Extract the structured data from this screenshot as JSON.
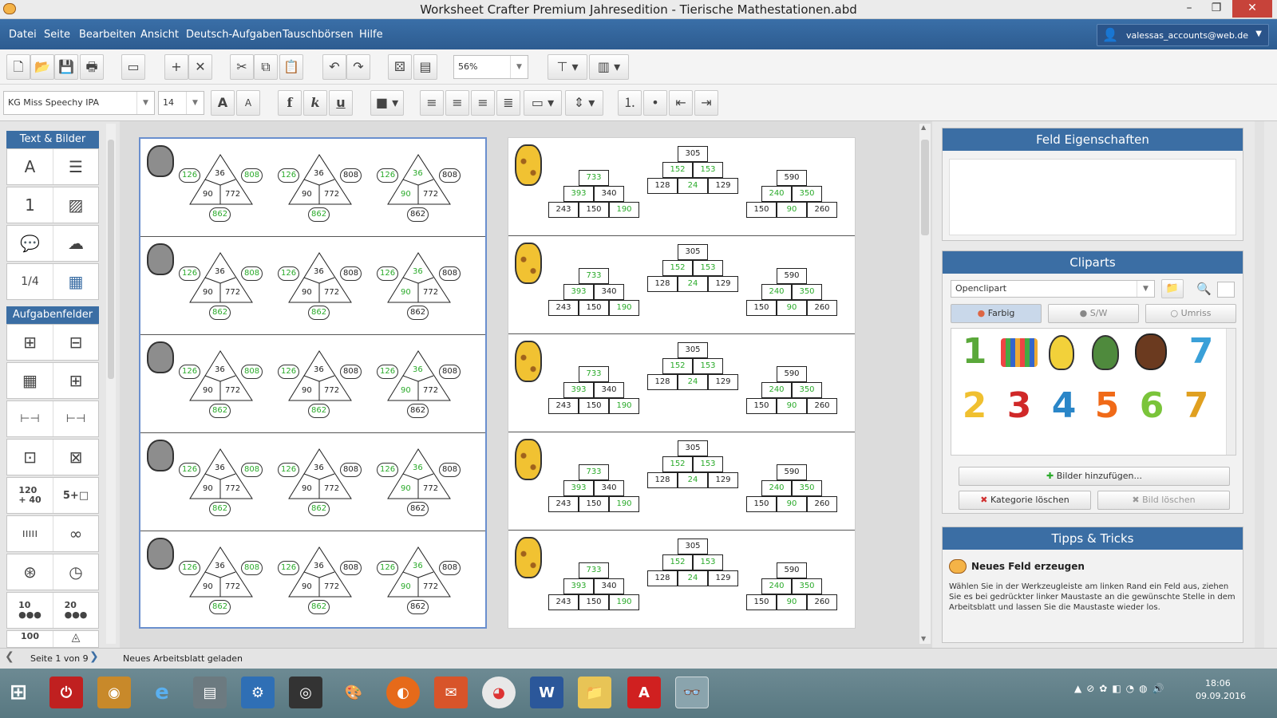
{
  "window": {
    "title": "Worksheet Crafter Premium Jahresedition - Tierische Mathestationen.abd",
    "minimize": "–",
    "maximize": "❐",
    "close": "✕"
  },
  "menu": [
    "Datei",
    "Seite",
    "Bearbeiten",
    "Ansicht",
    "Deutsch-Aufgaben",
    "Tauschbörsen",
    "Hilfe"
  ],
  "account": {
    "email": "valessas_accounts@web.de"
  },
  "toolbar": {
    "zoom": "56%",
    "font_name": "KG Miss Speechy IPA",
    "font_size": "14",
    "bold": "f",
    "italic": "k",
    "underline": "u"
  },
  "left_panel": {
    "sections": [
      "Text & Bilder",
      "Aufgabenfelder"
    ],
    "tools_text": [
      "A",
      "☰",
      "1",
      "▨",
      "💬",
      "☁",
      "1/4",
      "▦"
    ],
    "tools_tasks": [
      "⊞",
      "⊟",
      "▦",
      "⊞",
      "⊢⊣",
      "⊢⊣",
      "⊡",
      "⊠",
      "120\n+ 40",
      "5+□",
      "ııııı",
      "∞",
      "⊛",
      "◷",
      "10\n●●●",
      "20\n●●●",
      "100"
    ]
  },
  "worksheet": {
    "triangle": {
      "top": "36",
      "bottom_left": "90",
      "bottom_right": "772",
      "left": "126",
      "right": "808",
      "below": "862"
    },
    "pyr_a": {
      "top": "733",
      "mid": [
        "393",
        "340"
      ],
      "bottom": [
        "243",
        "150",
        "190"
      ]
    },
    "pyr_b": {
      "top": "305",
      "mid": [
        "152",
        "153"
      ],
      "bottom": [
        "128",
        "24",
        "129"
      ]
    },
    "pyr_c": {
      "top": "590",
      "mid": [
        "240",
        "350"
      ],
      "bottom": [
        "150",
        "90",
        "260"
      ]
    }
  },
  "right_panel": {
    "field_props_title": "Feld Eigenschaften",
    "cliparts_title": "Cliparts",
    "clipart_source": "Openclipart",
    "tabs": [
      "Farbig",
      "S/W",
      "Umriss"
    ],
    "clip_numbers": [
      "1",
      "7",
      "2",
      "3",
      "4",
      "5",
      "6",
      "7"
    ],
    "add_images": "Bilder hinzufügen...",
    "delete_category": "Kategorie löschen",
    "delete_image": "Bild löschen",
    "tips_title": "Tipps & Tricks",
    "tip_heading": "Neues Feld erzeugen",
    "tip_text": "Wählen Sie in der Werkzeugleiste am linken Rand ein Feld aus, ziehen Sie es bei gedrückter linker Maustaste an die gewünschte Stelle in dem Arbeitsblatt und lassen Sie die Maustaste wieder los."
  },
  "status": {
    "page": "Seite 1 von 9",
    "message": "Neues Arbeitsblatt geladen"
  },
  "taskbar": {
    "time": "18:06",
    "date": "09.09.2016"
  },
  "colors": {
    "accent": "#3b6ea4",
    "green": "#2aaa2a",
    "menubar": "#2d5c90"
  }
}
